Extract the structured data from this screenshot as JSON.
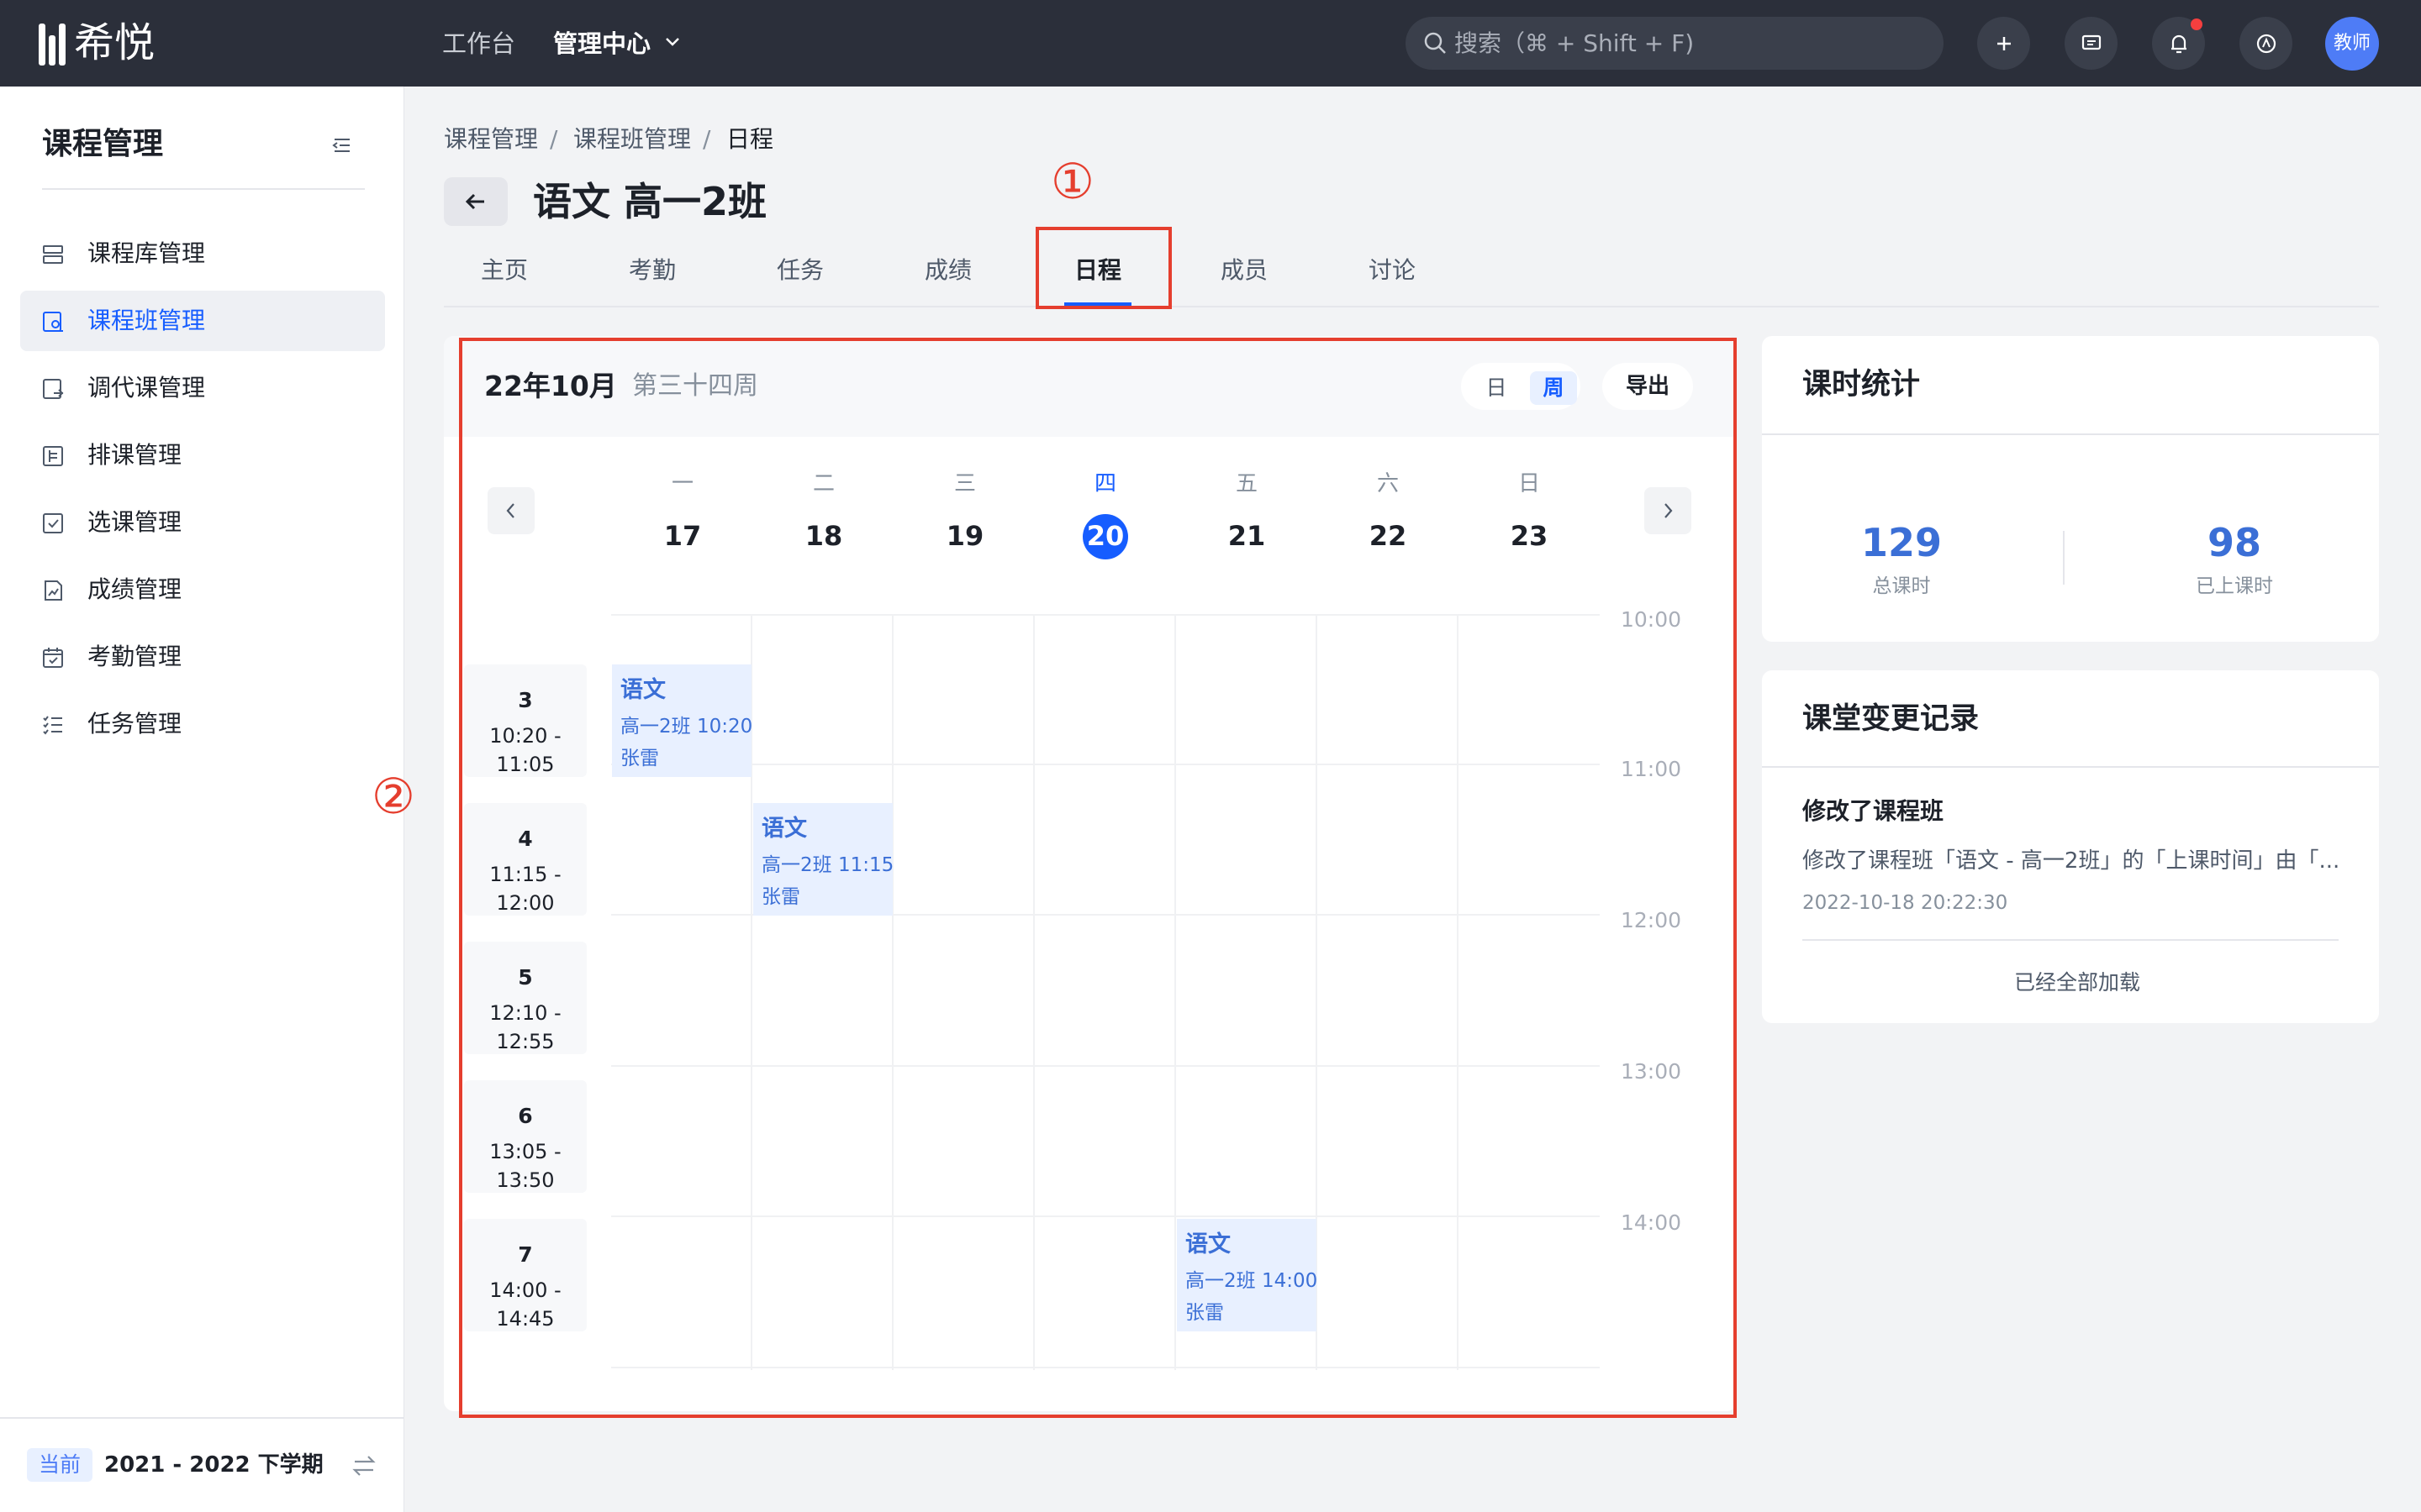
{
  "topbar": {
    "brand": "希悦",
    "nav": [
      "工作台",
      "管理中心"
    ],
    "search_placeholder": "搜索（⌘ + Shift + F)",
    "avatar_label": "教师"
  },
  "sidebar": {
    "title": "课程管理",
    "items": [
      {
        "label": "课程库管理",
        "active": false
      },
      {
        "label": "课程班管理",
        "active": true
      },
      {
        "label": "调代课管理",
        "active": false
      },
      {
        "label": "排课管理",
        "active": false
      },
      {
        "label": "选课管理",
        "active": false
      },
      {
        "label": "成绩管理",
        "active": false
      },
      {
        "label": "考勤管理",
        "active": false
      },
      {
        "label": "任务管理",
        "active": false
      }
    ],
    "term_tag": "当前",
    "term": "2021 - 2022 下学期"
  },
  "breadcrumb": [
    "课程管理",
    "课程班管理",
    "日程"
  ],
  "breadcrumb_sep": "/",
  "page_title": "语文 高一2班",
  "tabs": [
    "主页",
    "考勤",
    "任务",
    "成绩",
    "日程",
    "成员",
    "讨论"
  ],
  "active_tab": "日程",
  "annotations": [
    "①",
    "②"
  ],
  "calendar": {
    "month": "22年10月",
    "week": "第三十四周",
    "view_options": [
      "日",
      "周"
    ],
    "active_view": "周",
    "export": "导出",
    "days": [
      {
        "dow": "一",
        "date": "17"
      },
      {
        "dow": "二",
        "date": "18"
      },
      {
        "dow": "三",
        "date": "19"
      },
      {
        "dow": "四",
        "date": "20",
        "today": true
      },
      {
        "dow": "五",
        "date": "21"
      },
      {
        "dow": "六",
        "date": "22"
      },
      {
        "dow": "日",
        "date": "23"
      }
    ],
    "time_labels": [
      "10:00",
      "11:00",
      "12:00",
      "13:00",
      "14:00"
    ],
    "periods": [
      {
        "num": "3",
        "time": "10:20 - 11:05"
      },
      {
        "num": "4",
        "time": "11:15 - 12:00"
      },
      {
        "num": "5",
        "time": "12:10 - 12:55"
      },
      {
        "num": "6",
        "time": "13:05 - 13:50"
      },
      {
        "num": "7",
        "time": "14:00 - 14:45"
      }
    ],
    "events": [
      {
        "title": "语文",
        "detail": "高一2班  10:20",
        "teacher": "张雷",
        "day": "一",
        "period": "3"
      },
      {
        "title": "语文",
        "detail": "高一2班  11:15",
        "teacher": "张雷",
        "day": "二",
        "period": "4"
      },
      {
        "title": "语文",
        "detail": "高一2班  14:00",
        "teacher": "张雷",
        "day": "五",
        "period": "7"
      }
    ]
  },
  "stats": {
    "title": "课时统计",
    "total": "129",
    "total_label": "总课时",
    "done": "98",
    "done_label": "已上课时"
  },
  "changelog": {
    "title": "课堂变更记录",
    "entry_title": "修改了课程班",
    "entry_desc": "修改了课程班「语文 - 高一2班」的「上课时间」由「...",
    "entry_time": "2022-10-18 20:22:30",
    "end_text": "已经全部加载"
  },
  "colors": {
    "accent": "#165dff",
    "topbar": "#2b2f3a",
    "annotation": "#e53e2e",
    "event_bg": "#e8f0ff"
  }
}
